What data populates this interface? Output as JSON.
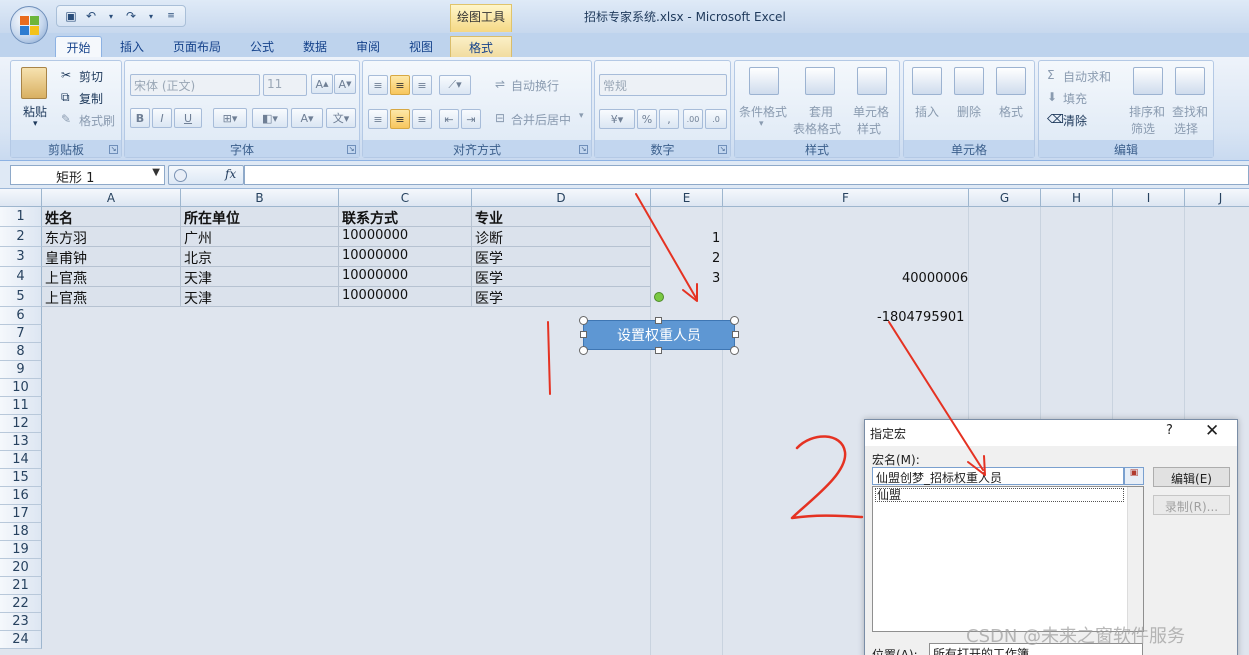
{
  "window": {
    "title": "招标专家系统.xlsx - Microsoft Excel",
    "context_tool": "绘图工具"
  },
  "ribbon": {
    "tabs": [
      "开始",
      "插入",
      "页面布局",
      "公式",
      "数据",
      "审阅",
      "视图",
      "格式"
    ],
    "active_tab": "开始",
    "clipboard": {
      "paste": "粘贴",
      "cut": "剪切",
      "copy": "复制",
      "format_painter": "格式刷",
      "label": "剪贴板"
    },
    "font": {
      "name": "宋体 (正文)",
      "size": "11",
      "label": "字体",
      "bold": "B",
      "italic": "I",
      "underline": "U"
    },
    "alignment": {
      "wrap": "自动换行",
      "merge": "合并后居中",
      "label": "对齐方式"
    },
    "number": {
      "format": "常规",
      "label": "数字"
    },
    "styles": {
      "conditional": "条件格式",
      "table1": "套用",
      "table2": "表格格式",
      "cell1": "单元格",
      "cell2": "样式",
      "label": "样式"
    },
    "cells": {
      "insert": "插入",
      "delete": "删除",
      "format": "格式",
      "label": "单元格"
    },
    "editing": {
      "autosum": "自动求和",
      "fill": "填充",
      "clear": "清除",
      "sort1": "排序和",
      "sort2": "筛选",
      "find1": "查找和",
      "find2": "选择",
      "label": "编辑"
    }
  },
  "formula_bar": {
    "name_box": "矩形 1",
    "fx": "fx",
    "formula": ""
  },
  "sheet": {
    "columns": [
      "A",
      "B",
      "C",
      "D",
      "E",
      "F",
      "G",
      "H",
      "I",
      "J"
    ],
    "rows": [
      "1",
      "2",
      "3",
      "4",
      "5",
      "6",
      "7",
      "8",
      "9",
      "10",
      "11",
      "12",
      "13",
      "14",
      "15",
      "16",
      "17",
      "18",
      "19",
      "20",
      "21",
      "22",
      "23",
      "24"
    ],
    "table": [
      [
        "姓名",
        "所在单位",
        "联系方式",
        "专业"
      ],
      [
        "东方羽",
        "广州",
        "10000000",
        "诊断"
      ],
      [
        "皇甫钟",
        "北京",
        "10000000",
        "医学"
      ],
      [
        "上官燕",
        "天津",
        "10000000",
        "医学"
      ],
      [
        "上官燕",
        "天津",
        "10000000",
        "医学"
      ]
    ],
    "e_values": [
      "1",
      "2",
      "3"
    ],
    "f4": "40000006",
    "f6": "-1804795901"
  },
  "shape": {
    "label": "设置权重人员"
  },
  "dialog": {
    "title": "指定宏",
    "help": "?",
    "close": "✕",
    "macro_name_label": "宏名(M):",
    "macro_name_value": "仙盟创梦_招标权重人员",
    "list_item": "仙盟",
    "edit_button": "编辑(E)",
    "record_button": "录制(R)...",
    "location_label": "位置(A):",
    "location_value": "所有打开的工作簿"
  },
  "watermark": "CSDN @未来之窗软件服务",
  "colors": {
    "annotation": "#e53222",
    "shape_fill": "#5e97d3"
  }
}
